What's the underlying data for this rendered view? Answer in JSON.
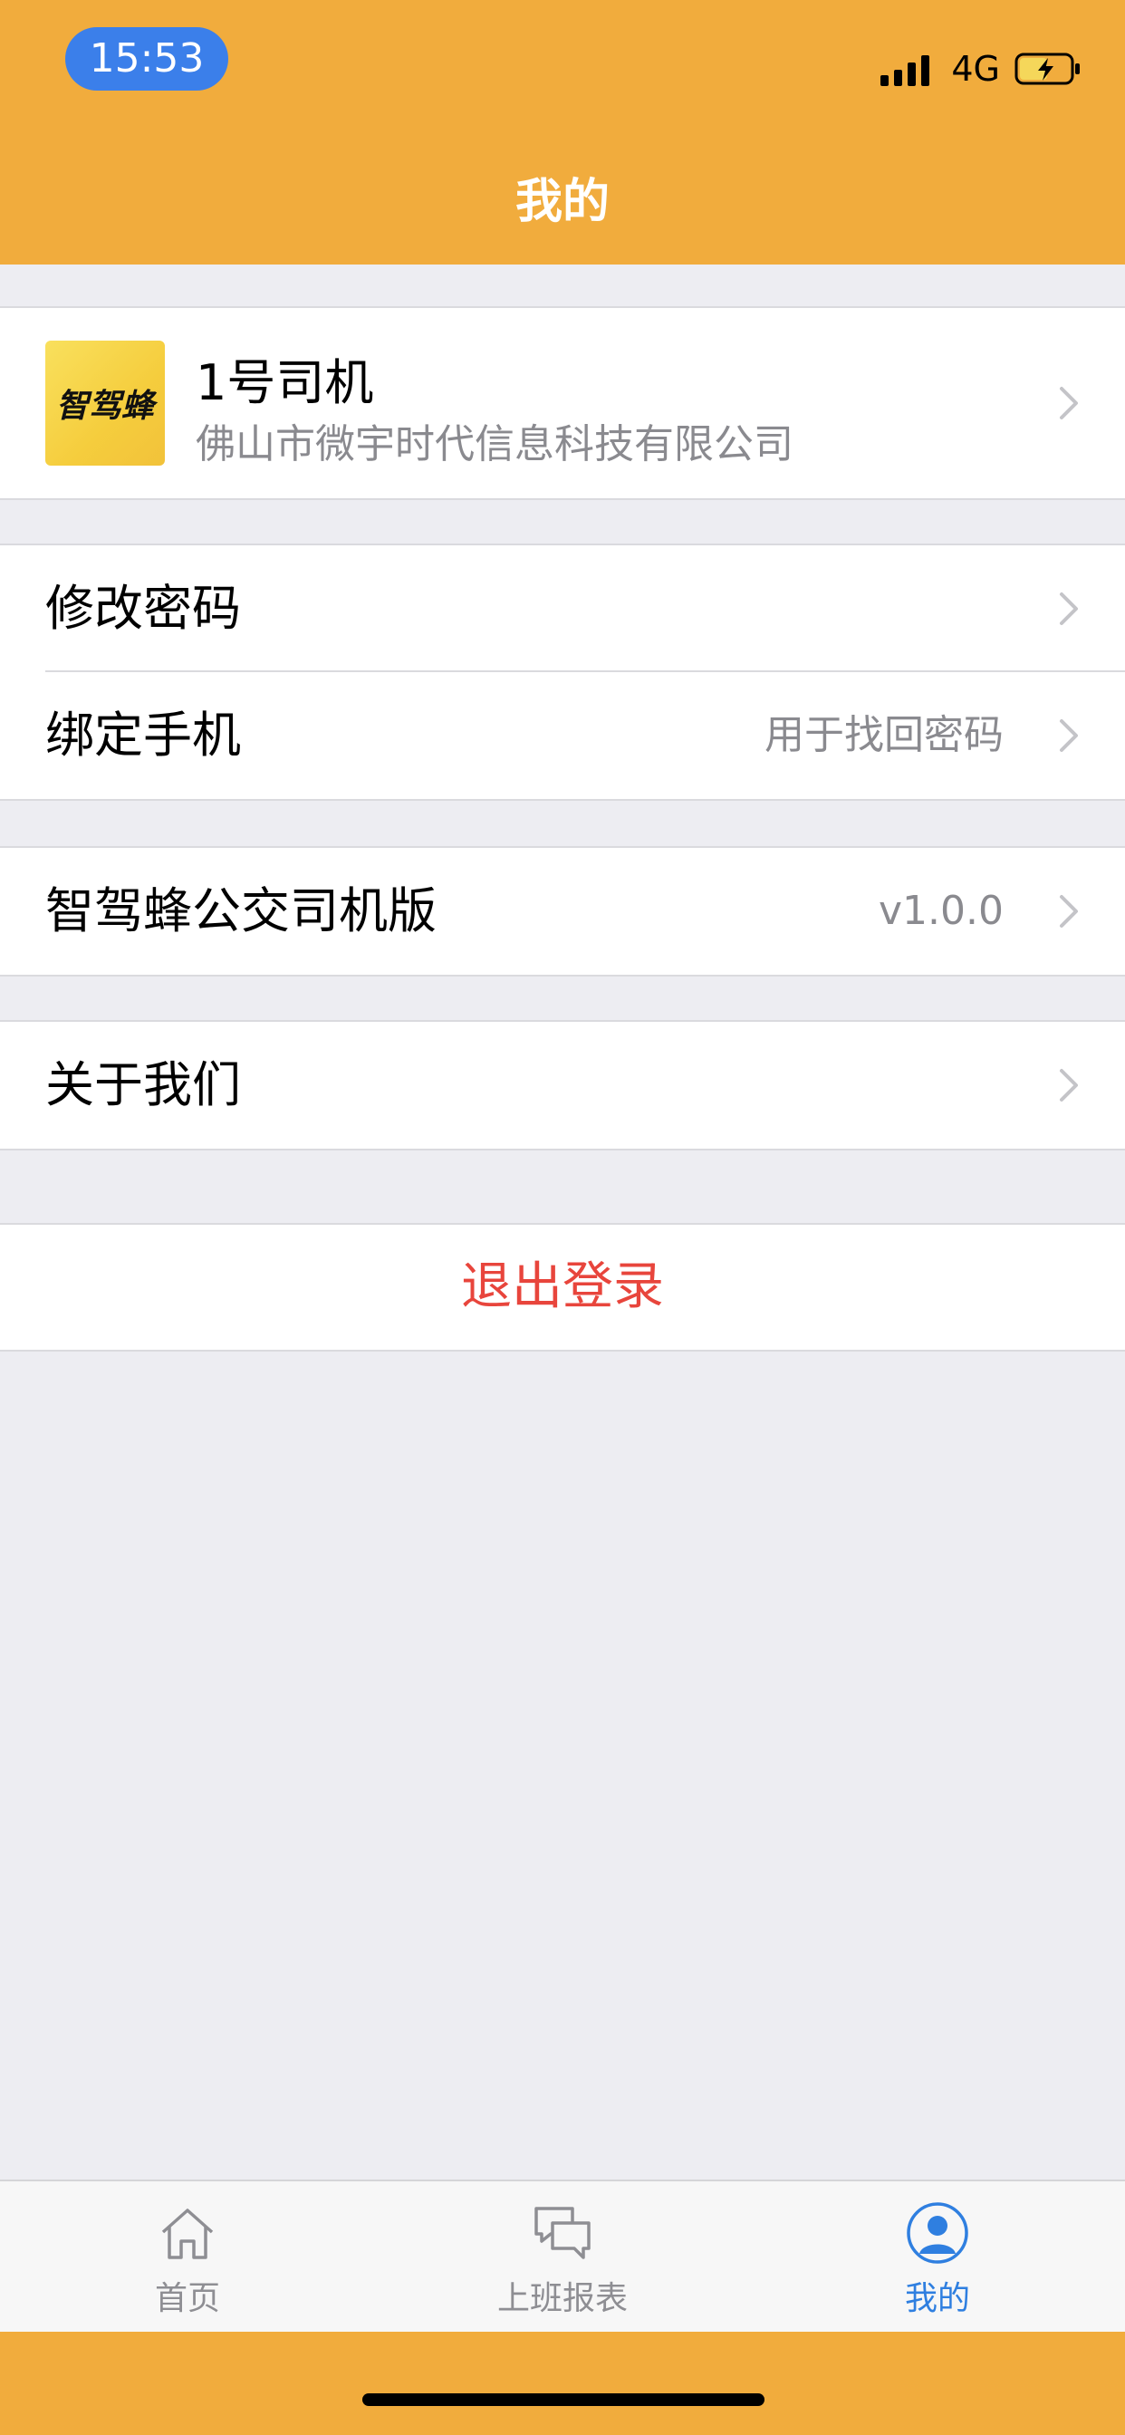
{
  "status_bar": {
    "time": "15:53",
    "network": "4G"
  },
  "header": {
    "title": "我的"
  },
  "profile": {
    "logo_text": "智驾蜂",
    "name": "1号司机",
    "company": "佛山市微宇时代信息科技有限公司"
  },
  "account": {
    "change_password": {
      "label": "修改密码"
    },
    "bind_phone": {
      "label": "绑定手机",
      "detail": "用于找回密码"
    }
  },
  "app_version": {
    "label": "智驾蜂公交司机版",
    "detail": "v1.0.0"
  },
  "about": {
    "label": "关于我们"
  },
  "logout": {
    "label": "退出登录"
  },
  "tabbar": {
    "tabs": [
      {
        "label": "首页",
        "icon": "home-icon",
        "active": false
      },
      {
        "label": "上班报表",
        "icon": "chat-bubbles-icon",
        "active": false
      },
      {
        "label": "我的",
        "icon": "user-icon",
        "active": true
      }
    ]
  },
  "colors": {
    "brand_orange": "#F1AC3D",
    "time_pill": "#3B7FEA",
    "logout_red": "#E8453C",
    "tab_active": "#2F7FE0",
    "tab_inactive": "#8E8E93",
    "background": "#EDEDF2"
  }
}
